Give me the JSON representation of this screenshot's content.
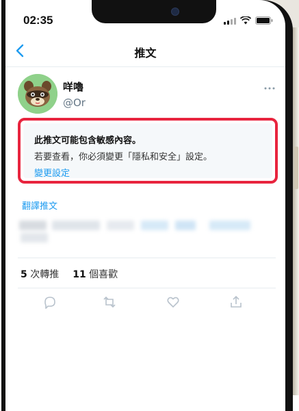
{
  "status_bar": {
    "time": "02:35"
  },
  "nav": {
    "title": "推文",
    "back_icon": "chevron-left-icon"
  },
  "tweet": {
    "display_name": "咩嚕",
    "handle": "@Or",
    "more_icon": "more-horizontal-icon",
    "warning": {
      "title": "此推文可能包含敏感內容。",
      "body": "若要查看，你必須變更「隱私和安全」設定。",
      "link": "變更設定"
    },
    "translate_link": "翻譯推文",
    "stats": {
      "retweets_count": "5",
      "retweets_label": "次轉推",
      "likes_count": "11",
      "likes_label": "個喜歡"
    },
    "actions": [
      "reply-icon",
      "retweet-icon",
      "like-icon",
      "share-icon"
    ]
  },
  "colors": {
    "accent": "#1d9bf0",
    "warning_border": "#e8243e",
    "icon_gray": "#b8c2cc"
  }
}
